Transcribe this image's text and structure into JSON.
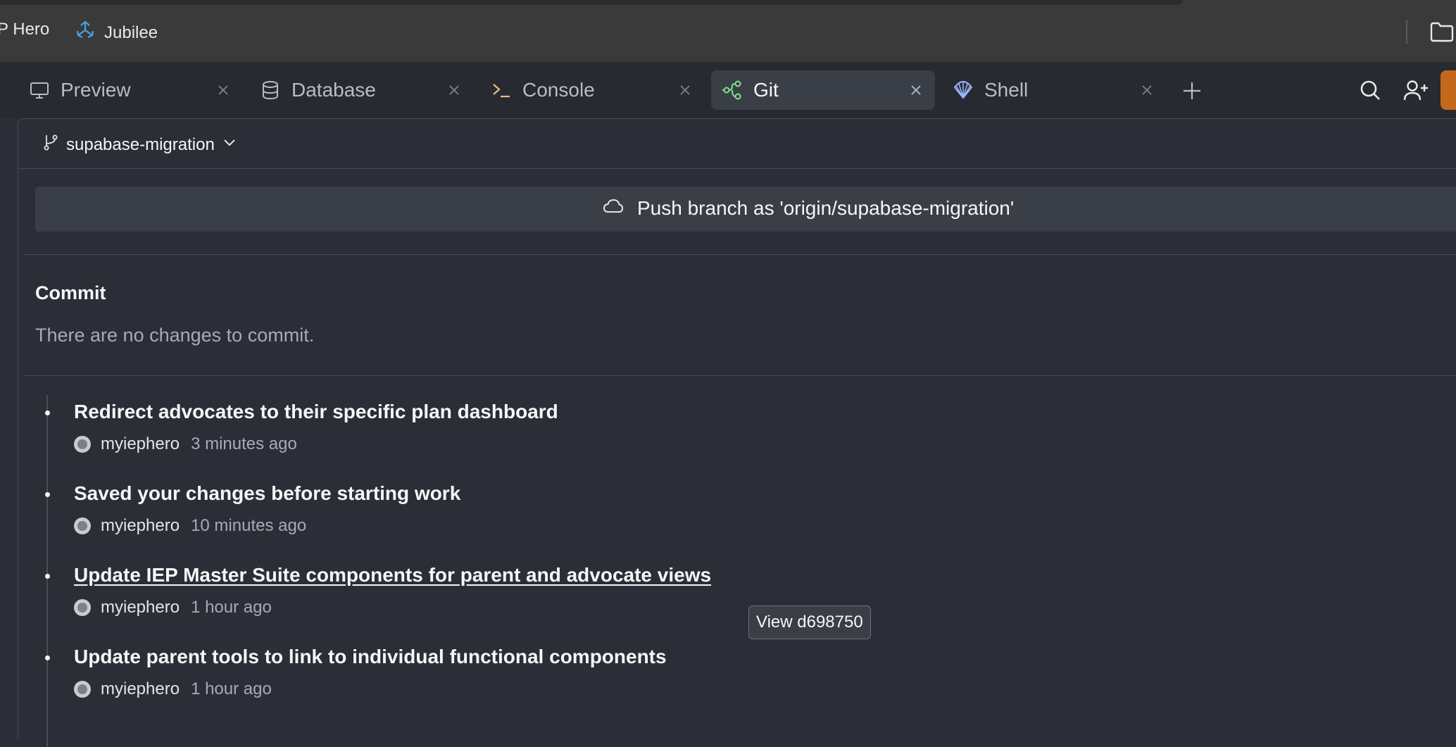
{
  "bookmarks": [
    {
      "label": "P Hero"
    },
    {
      "label": "Jubilee",
      "icon": "jubilee-logo-icon"
    }
  ],
  "tabs": [
    {
      "label": "Preview",
      "icon": "monitor-icon",
      "active": false
    },
    {
      "label": "Database",
      "icon": "database-icon",
      "active": false
    },
    {
      "label": "Console",
      "icon": "terminal-icon",
      "active": false
    },
    {
      "label": "Git",
      "icon": "git-icon",
      "active": true
    },
    {
      "label": "Shell",
      "icon": "shell-icon",
      "active": false
    }
  ],
  "git": {
    "branch": "supabase-migration",
    "push_label": "Push branch as 'origin/supabase-migration'",
    "commit_heading": "Commit",
    "commit_empty": "There are no changes to commit.",
    "commits": [
      {
        "message": "Redirect advocates to their specific plan dashboard",
        "author": "myiephero",
        "time": "3 minutes ago"
      },
      {
        "message": "Saved your changes before starting work",
        "author": "myiephero",
        "time": "10 minutes ago"
      },
      {
        "message": "Update IEP Master Suite components for parent and advocate views",
        "author": "myiephero",
        "time": "1 hour ago"
      },
      {
        "message": "Update parent tools to link to individual functional components",
        "author": "myiephero",
        "time": "1 hour ago"
      }
    ]
  },
  "tooltip": "View d698750",
  "colors": {
    "accent_orange": "#c4691c",
    "git_icon": "#7ee787",
    "console_icon": "#e5c07b",
    "jubilee_icon": "#4aa3df"
  }
}
